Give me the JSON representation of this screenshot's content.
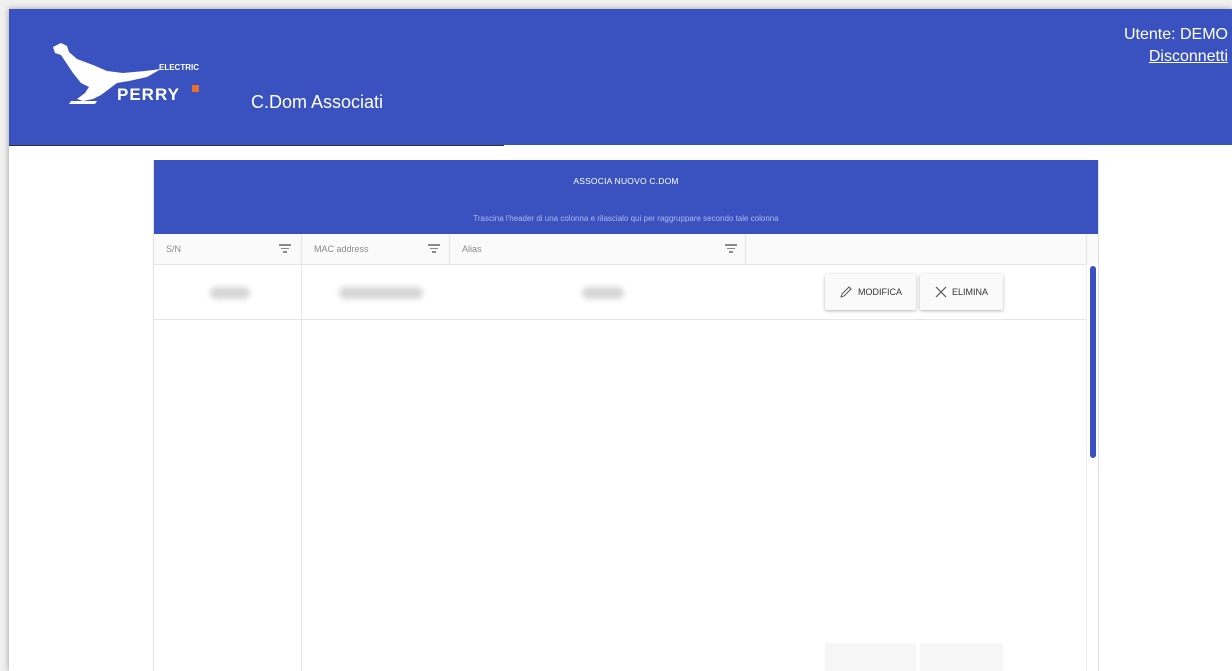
{
  "header": {
    "app_title": "C.Dom Associati",
    "user_label": "Utente: DEMO",
    "logout_label": "Disconnetti",
    "logo_text_top": "ELECTRIC",
    "logo_text_bottom": "PERRY"
  },
  "panel": {
    "add_label": "ASSOCIA NUOVO C.DOM",
    "group_hint": "Trascina l'header di una colonna e rilascialo qui per raggruppare secondo tale colonna",
    "columns": [
      {
        "label": "S/N"
      },
      {
        "label": "MAC address"
      },
      {
        "label": "Alias"
      },
      {
        "label": ""
      }
    ],
    "rows": [
      {
        "sn": "",
        "mac": "",
        "alias": "",
        "edit_label": "MODIFICA",
        "delete_label": "ELIMINA"
      }
    ]
  },
  "colors": {
    "accent": "#3a52bf",
    "hint": "#aeb9ec"
  },
  "icons": {
    "filter": "filter-icon",
    "edit": "pencil-icon",
    "delete": "close-icon"
  }
}
